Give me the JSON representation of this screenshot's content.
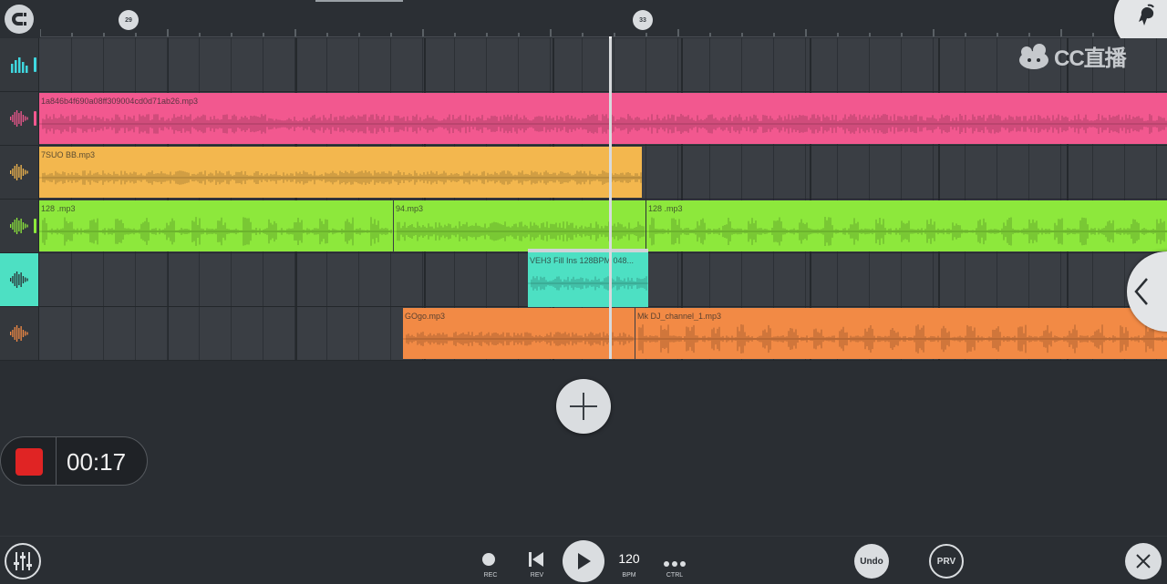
{
  "ruler": {
    "markers": [
      "29",
      "33"
    ]
  },
  "watermark": {
    "text": "CC直播"
  },
  "tracks": [
    {
      "id": "track-1",
      "icon": "equalizer-icon",
      "color": "#3fd8e0",
      "clips": []
    },
    {
      "id": "track-2",
      "icon": "waveform-icon",
      "color": "#f2588f",
      "clips": [
        {
          "label": "1a846b4f690a08ff309004cd0d71ab26.mp3",
          "color": "#f2588f"
        }
      ]
    },
    {
      "id": "track-3",
      "icon": "waveform-icon",
      "color": "#f3b74e",
      "clips": [
        {
          "label": "7SUO BB.mp3",
          "color": "#f3b74e"
        }
      ]
    },
    {
      "id": "track-4",
      "icon": "waveform-icon",
      "color": "#8de83c",
      "clips": [
        {
          "label": "128 .mp3",
          "color": "#8de83c"
        },
        {
          "label": "94.mp3",
          "color": "#8de83c"
        },
        {
          "label": "128 .mp3",
          "color": "#8de83c"
        }
      ]
    },
    {
      "id": "track-5",
      "icon": "waveform-icon",
      "color": "#4de0c3",
      "clips": [
        {
          "label": "VEH3 Fill Ins 128BPM 048...",
          "color": "#4de0c3"
        }
      ]
    },
    {
      "id": "track-6",
      "icon": "waveform-icon",
      "color": "#f28a45",
      "clips": [
        {
          "label": "GOgo.mp3",
          "color": "#f28a45"
        },
        {
          "label": "Mk DJ_channel_1.mp3",
          "color": "#f28a45"
        }
      ]
    }
  ],
  "recorder": {
    "time": "00:17"
  },
  "transport": {
    "rec_label": "REC",
    "rev_label": "REV",
    "bpm_value": "120",
    "bpm_label": "BPM",
    "ctrl_label": "CTRL",
    "undo_label": "Undo",
    "prv_label": "PRV"
  },
  "colors": {
    "background": "#2a2e33",
    "record_red": "#e02424",
    "playhead": "#d8dadd"
  }
}
